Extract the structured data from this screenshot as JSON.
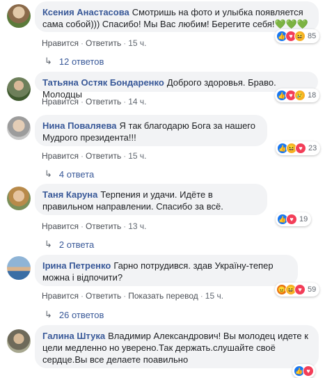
{
  "comments": [
    {
      "author": "Ксения Анастасова",
      "text": "Смотришь на фото и улыбка появляется сама собой))) Спасибо! Мы Вас любим! Берегите себя!",
      "emoji": "💚💚💚",
      "reactions": [
        "like",
        "love",
        "haha"
      ],
      "reaction_count": "85",
      "like": "Нравится",
      "reply": "Ответить",
      "time": "15 ч.",
      "replies": "12 ответов"
    },
    {
      "author": "Татьяна Остяк Бондаренко",
      "text": "Доброго здоровья. Браво. Молодцы",
      "reactions": [
        "like",
        "love",
        "sad"
      ],
      "reaction_count": "18",
      "like": "Нравится",
      "reply": "Ответить",
      "time": "14 ч."
    },
    {
      "author": "Нина Поваляева",
      "text": "Я так благодарю Бога за нашего Мудрого президента!!!",
      "reactions": [
        "like",
        "haha",
        "love"
      ],
      "reaction_count": "23",
      "like": "Нравится",
      "reply": "Ответить",
      "time": "15 ч.",
      "replies": "4 ответа"
    },
    {
      "author": "Таня Каруна",
      "text": "Терпения и удачи. Идёте в правильном направлении. Спасибо за всё.",
      "reactions": [
        "like",
        "love"
      ],
      "reaction_count": "19",
      "like": "Нравится",
      "reply": "Ответить",
      "time": "13 ч.",
      "replies": "2 ответа"
    },
    {
      "author": "Ірина Петренко",
      "text": "Гарно потрудився. здав Україну-тепер можна і відпочити?",
      "reactions": [
        "angry",
        "haha",
        "love"
      ],
      "reaction_count": "59",
      "like": "Нравится",
      "reply": "Ответить",
      "translate": "Показать перевод",
      "time": "15 ч.",
      "replies": "26 ответов"
    },
    {
      "author": "Галина Штука",
      "text": "Владимир Александрович! Вы молодец идете к цели медленно но уверено.Так держать.слушайте своё сердце.Вы все делаете поавильно",
      "reactions": [
        "like",
        "love"
      ]
    }
  ],
  "colors": {
    "link": "#385898",
    "bubble": "#f2f3f5",
    "meta": "#606770"
  }
}
